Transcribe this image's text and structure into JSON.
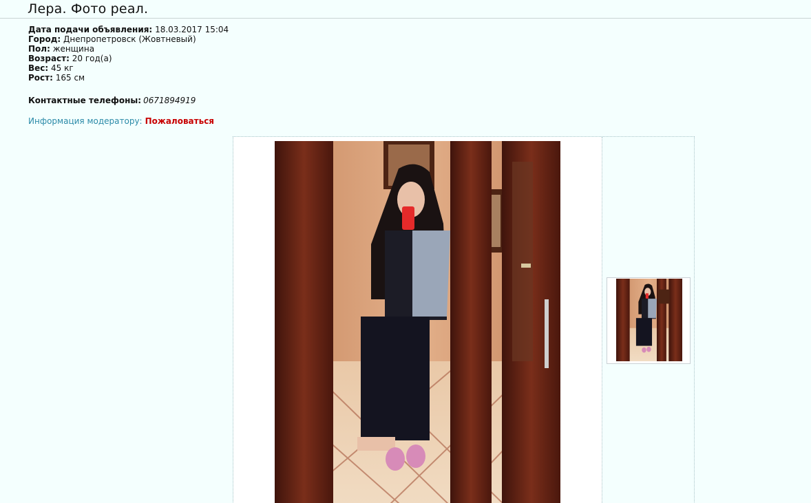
{
  "ad": {
    "title": "Лера. Фото реал.",
    "fields": [
      {
        "label": "Дата подачи объявления:",
        "value": "18.03.2017 15:04"
      },
      {
        "label": "Город:",
        "value": "Днепропетровск (Жовтневый)"
      },
      {
        "label": "Пол:",
        "value": "женщина"
      },
      {
        "label": "Возраст:",
        "value": "20 год(а)"
      },
      {
        "label": "Вес:",
        "value": "45 кг"
      },
      {
        "label": "Рост:",
        "value": "165 см"
      }
    ],
    "phones_label": "Контактные телефоны:",
    "phone": "0671894919",
    "moderator_label": "Информация модератору:",
    "complain_link": "Пожаловаться"
  },
  "colors": {
    "page_background": "#f4fffe",
    "moderator_label": "#2a8aa8",
    "complain_link": "#c80000"
  },
  "gallery": {
    "main_photo_icon": "photo-of-woman-in-mirror",
    "thumbnail_icon": "photo-thumbnail"
  }
}
